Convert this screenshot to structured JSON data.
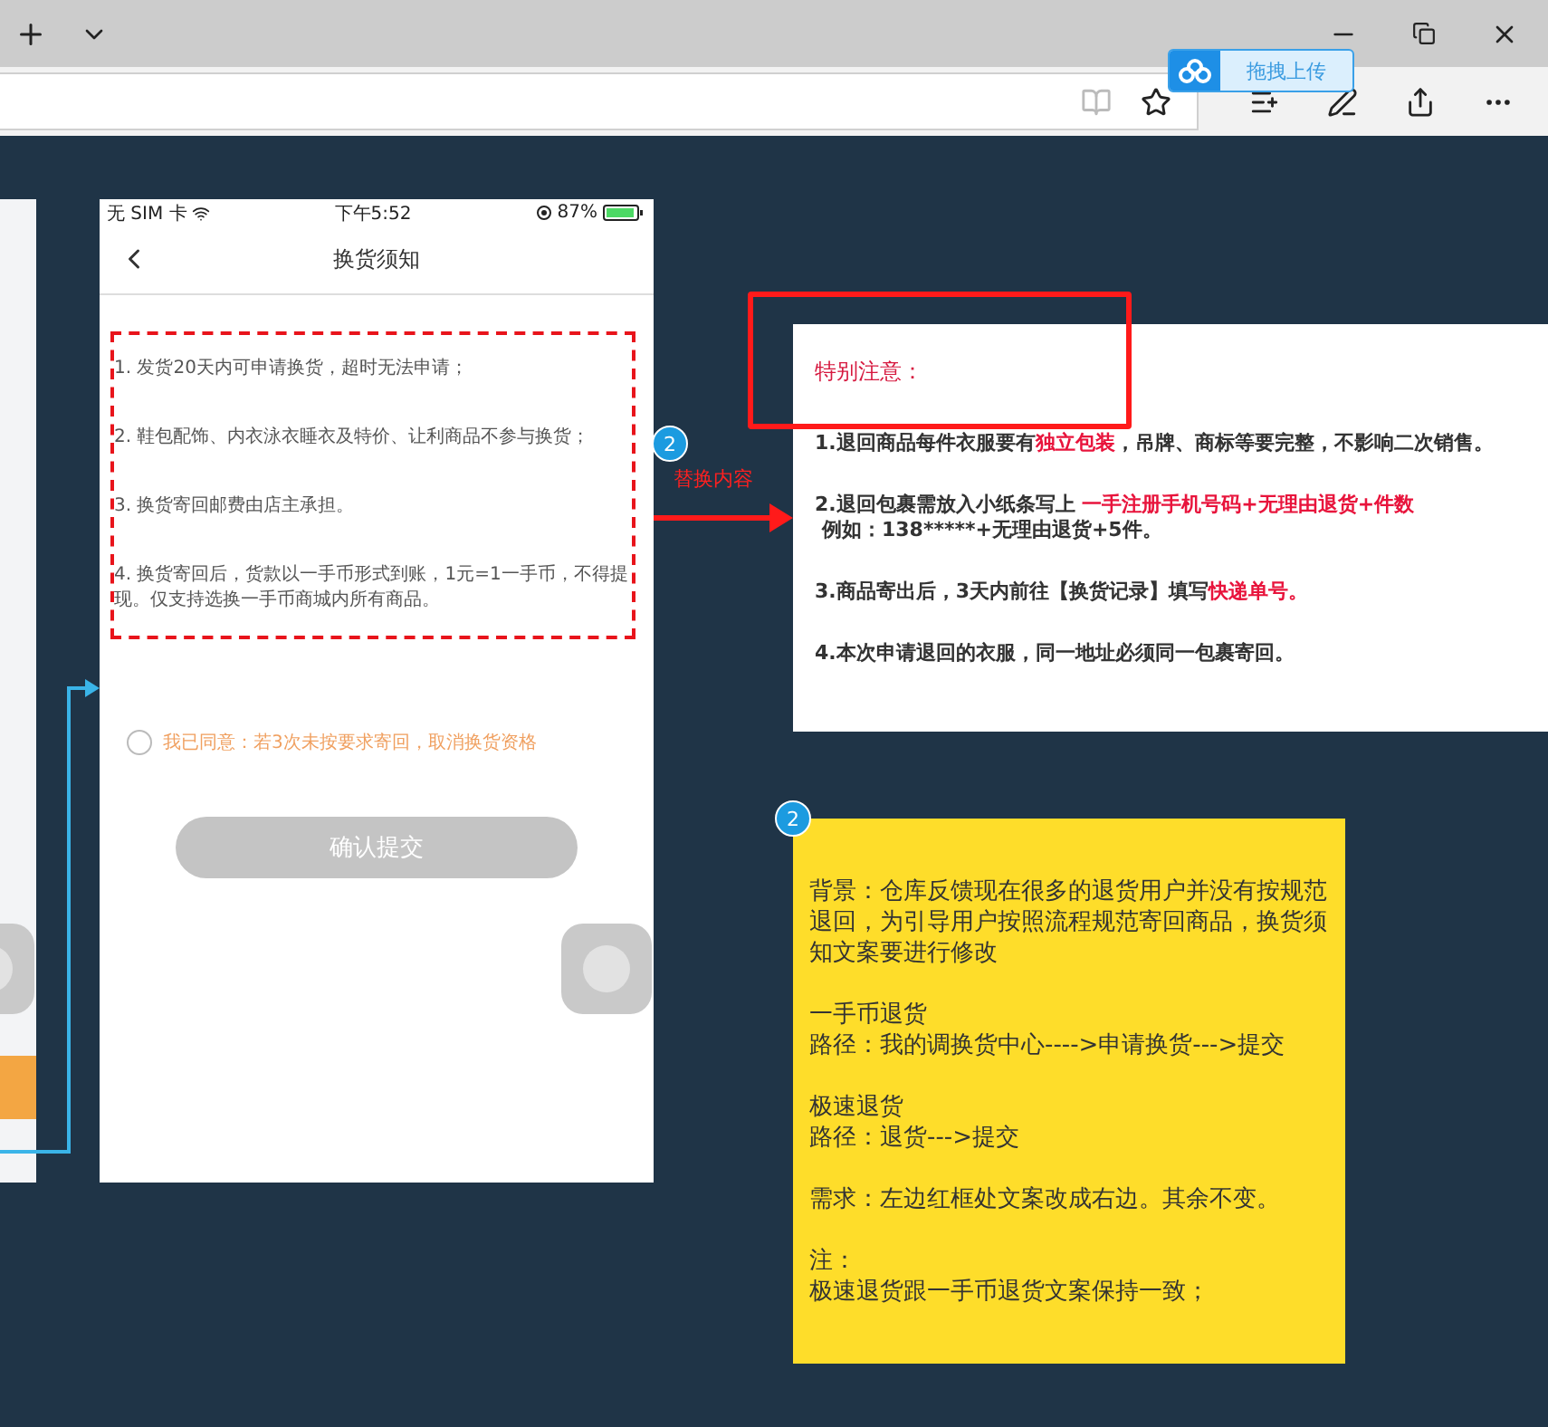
{
  "browser": {
    "upload_badge": "拖拽上传"
  },
  "side_phone": {
    "kind": "partial"
  },
  "phone": {
    "status": {
      "carrier": "无 SIM 卡",
      "time": "下午5:52",
      "battery": "87%"
    },
    "title": "换货须知",
    "rules": [
      "1. 发货20天内可申请换货，超时无法申请；",
      "2. 鞋包配饰、内衣泳衣睡衣及特价、让利商品不参与换货；",
      "3. 换货寄回邮费由店主承担。",
      "4. 换货寄回后，货款以一手币形式到账，1元=1一手币，不得提现。仅支持选换一手币商城内所有商品。"
    ],
    "agree": {
      "label": "我已同意：若3次未按要求寄回，取消换货资格",
      "checked": false
    },
    "submit": {
      "label": "确认提交",
      "disabled": true
    }
  },
  "annotation": {
    "badge": "2",
    "label": "替换内容"
  },
  "notice": {
    "title": "特别注意：",
    "items": [
      {
        "segments": [
          {
            "text": "1.退回商品每件衣服要有",
            "highlight": false
          },
          {
            "text": "独立包装",
            "highlight": true
          },
          {
            "text": "，吊牌、商标等要完整，不影响二次销售。",
            "highlight": false
          }
        ]
      },
      {
        "segments": [
          {
            "text": "2.退回包裹需放入小纸条写上 ",
            "highlight": false
          },
          {
            "text": "一手注册手机号码+无理由退货+件数",
            "highlight": true
          }
        ],
        "example": "例如：138*****+无理由退货+5件。"
      },
      {
        "segments": [
          {
            "text": "3.商品寄出后，3天内前往【换货记录】填写",
            "highlight": false
          },
          {
            "text": "快递单号。",
            "highlight": true
          }
        ]
      },
      {
        "segments": [
          {
            "text": "4.本次申请退回的衣服，同一地址必须同一包裹寄回。",
            "highlight": false
          }
        ]
      }
    ]
  },
  "note": {
    "badge": "2",
    "paragraphs": [
      [
        "背景：仓库反馈现在很多的退货用户并没有按规范退回，为引导用户按照流程规范寄回商品，换货须知文案要进行修改"
      ],
      [
        "一手币退货",
        "路径：我的调换货中心---->申请换货--->提交"
      ],
      [
        "极速退货",
        "路径：退货--->提交"
      ],
      [
        "需求：左边红框处文案改成右边。其余不变。"
      ],
      [
        "注：",
        "极速退货跟一手币退货文案保持一致；"
      ]
    ]
  }
}
